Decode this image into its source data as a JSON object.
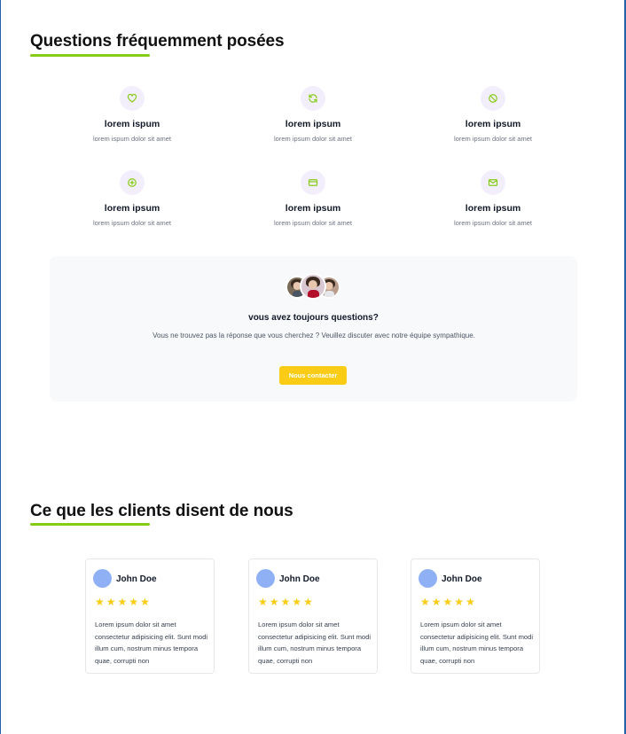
{
  "faq": {
    "title": "Questions fréquemment posées",
    "items": [
      {
        "icon": "heart-icon",
        "title": "lorem ispum",
        "description": "lorem ispum dolor sit amet"
      },
      {
        "icon": "refresh-icon",
        "title": "lorem ipsum",
        "description": "lorem ipsum dolor sit amet"
      },
      {
        "icon": "ban-icon",
        "title": "lorem ipsum",
        "description": "lorem ipsum dolor sit amet"
      },
      {
        "icon": "plus-circle-icon",
        "title": "lorem ipsum",
        "description": "lorem ipsum dolor sit amet"
      },
      {
        "icon": "credit-card-icon",
        "title": "lorem ipsum",
        "description": "lorem ipsum dolor sit amet"
      },
      {
        "icon": "mail-icon",
        "title": "lorem ipsum",
        "description": "lorem ipsum dolor sit amet"
      }
    ],
    "icon_color": "#84cc16"
  },
  "contact": {
    "title": "vous avez toujours questions?",
    "text": "Vous ne trouvez pas la réponse que vous cherchez ? Veuillez discuter avec notre équipe sympathique.",
    "button_label": "Nous contacter",
    "button_color": "#facc15"
  },
  "testimonials": {
    "title": "Ce que les clients disent de nous",
    "reviews": [
      {
        "name": "John Doe",
        "stars": 5,
        "text": "Lorem ipsum dolor sit amet consectetur adipisicing elit. Sunt modi illum cum, nostrum minus tempora quae, corrupti non"
      },
      {
        "name": "John Doe",
        "stars": 5,
        "text": "Lorem ipsum dolor sit amet consectetur adipisicing elit. Sunt modi illum cum, nostrum minus tempora quae, corrupti non"
      },
      {
        "name": "John Doe",
        "stars": 5,
        "text": "Lorem ipsum dolor sit amet consectetur adipisicing elit. Sunt modi illum cum, nostrum minus tempora quae, corrupti non"
      }
    ]
  },
  "colors": {
    "accent": "#84cc16",
    "star": "#facc15"
  }
}
